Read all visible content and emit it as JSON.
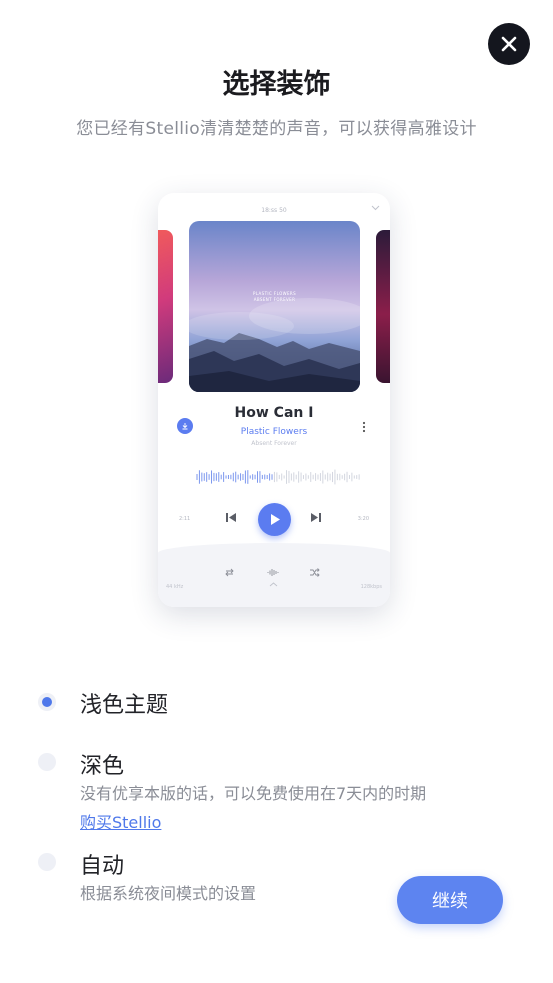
{
  "header": {
    "title": "选择装饰",
    "subtitle": "您已经有Stellio清清楚楚的声音，可以获得高雅设计"
  },
  "preview": {
    "status_time": "18:ss 50",
    "cover_text_line1": "PLASTIC FLOWERS",
    "cover_text_line2": "ABSENT FOREVER",
    "song_title": "How Can I",
    "song_artist": "Plastic Flowers",
    "song_album": "Absent Forever",
    "elapsed": "2:11",
    "duration": "3:20",
    "frequency": "44 kHz",
    "bitrate": "128kbps"
  },
  "options": [
    {
      "label": "浅色主题",
      "selected": true
    },
    {
      "label": "深色",
      "description": "没有优享本版的话，可以免费使用在7天内的时期",
      "link": "购买Stellio",
      "selected": false
    },
    {
      "label": "自动",
      "description": "根据系统夜间模式的设置",
      "selected": false
    }
  ],
  "continue_label": "继续",
  "colors": {
    "accent": "#5d84f0",
    "dark": "#14161e"
  },
  "icons": [
    "close-icon",
    "play-icon",
    "prev-icon",
    "next-icon",
    "download-icon",
    "more-icon",
    "repeat-icon",
    "equalizer-icon",
    "shuffle-icon",
    "chevron-down-icon",
    "chevron-up-icon"
  ]
}
